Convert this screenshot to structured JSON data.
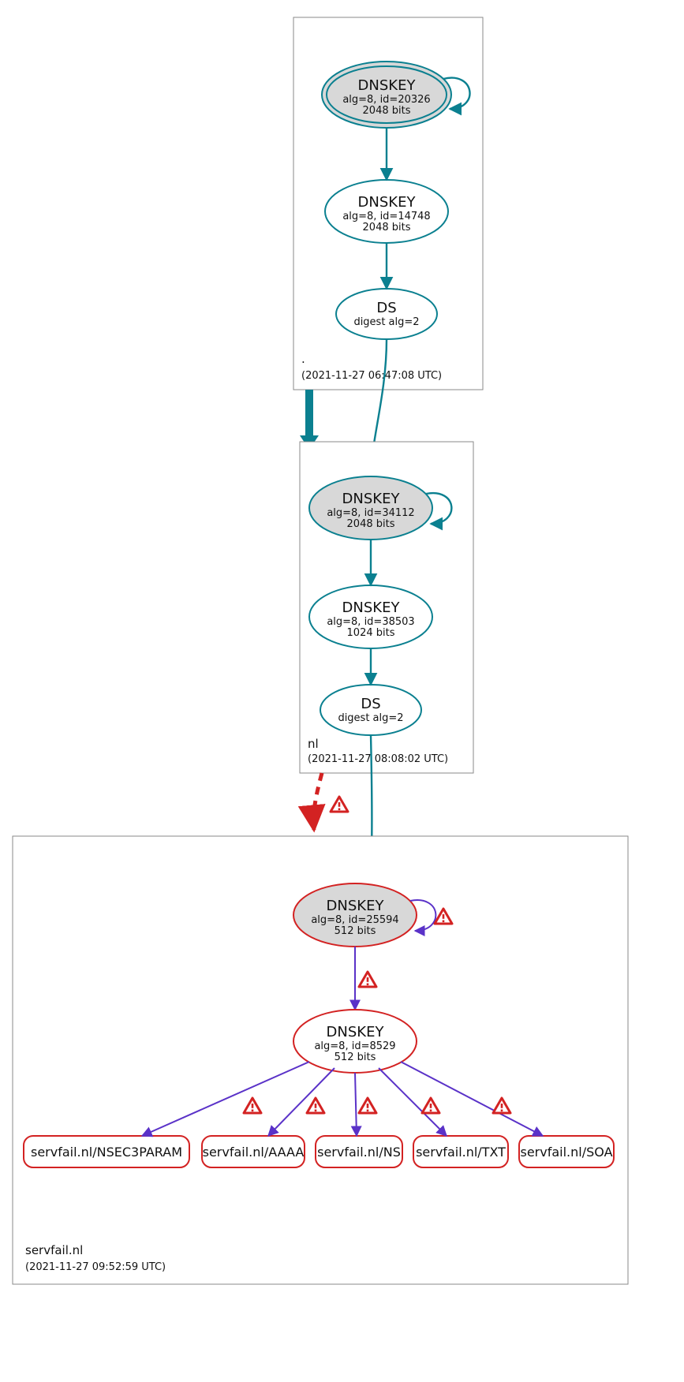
{
  "zones": [
    {
      "id": "root",
      "name": ".",
      "timestamp": "(2021-11-27 06:47:08 UTC)"
    },
    {
      "id": "nl",
      "name": "nl",
      "timestamp": "(2021-11-27 08:08:02 UTC)"
    },
    {
      "id": "sf",
      "name": "servfail.nl",
      "timestamp": "(2021-11-27 09:52:59 UTC)"
    }
  ],
  "nodes": {
    "root_ksk": {
      "title": "DNSKEY",
      "l2": "alg=8, id=20326",
      "l3": "2048 bits"
    },
    "root_zsk": {
      "title": "DNSKEY",
      "l2": "alg=8, id=14748",
      "l3": "2048 bits"
    },
    "root_ds": {
      "title": "DS",
      "l2": "digest alg=2"
    },
    "nl_ksk": {
      "title": "DNSKEY",
      "l2": "alg=8, id=34112",
      "l3": "2048 bits"
    },
    "nl_zsk": {
      "title": "DNSKEY",
      "l2": "alg=8, id=38503",
      "l3": "1024 bits"
    },
    "nl_ds": {
      "title": "DS",
      "l2": "digest alg=2"
    },
    "sf_ksk": {
      "title": "DNSKEY",
      "l2": "alg=8, id=25594",
      "l3": "512 bits"
    },
    "sf_zsk": {
      "title": "DNSKEY",
      "l2": "alg=8, id=8529",
      "l3": "512 bits"
    }
  },
  "rrsets": {
    "nsec3": "servfail.nl/NSEC3PARAM",
    "aaaa": "servfail.nl/AAAA",
    "ns": "servfail.nl/NS",
    "txt": "servfail.nl/TXT",
    "soa": "servfail.nl/SOA"
  },
  "colors": {
    "secure": "#0b8090",
    "bogus": "#d32222",
    "insecure": "#5a32c8",
    "grey": "#d8d8d8"
  }
}
